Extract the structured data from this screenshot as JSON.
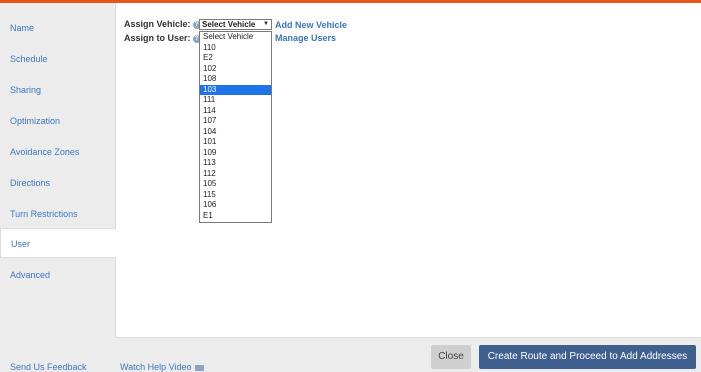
{
  "sidebar": {
    "items": [
      {
        "label": "Name"
      },
      {
        "label": "Schedule"
      },
      {
        "label": "Sharing"
      },
      {
        "label": "Optimization"
      },
      {
        "label": "Avoidance Zones"
      },
      {
        "label": "Directions"
      },
      {
        "label": "Turn Restrictions"
      },
      {
        "label": "User",
        "active": true
      },
      {
        "label": "Advanced"
      }
    ]
  },
  "form": {
    "assign_vehicle_label": "Assign Vehicle:",
    "assign_user_label": "Assign to User:",
    "vehicle_select_value": "Select Vehicle",
    "add_new_vehicle": "Add New Vehicle",
    "manage_users": "Manage Users",
    "vehicle_options": [
      "Select Vehicle",
      "110",
      "E2",
      "102",
      "108",
      "103",
      "111",
      "114",
      "107",
      "104",
      "101",
      "109",
      "113",
      "112",
      "105",
      "115",
      "106",
      "E1"
    ],
    "highlighted_option": "103"
  },
  "footer": {
    "feedback": "Send Us Feedback",
    "help_video": "Watch Help Video",
    "close": "Close",
    "primary": "Create Route and Proceed to Add Addresses"
  },
  "colors": {
    "accent": "#e8541e",
    "link": "#3b78c0",
    "primary_button": "#3f5f8f",
    "highlight": "#1e73e8"
  }
}
